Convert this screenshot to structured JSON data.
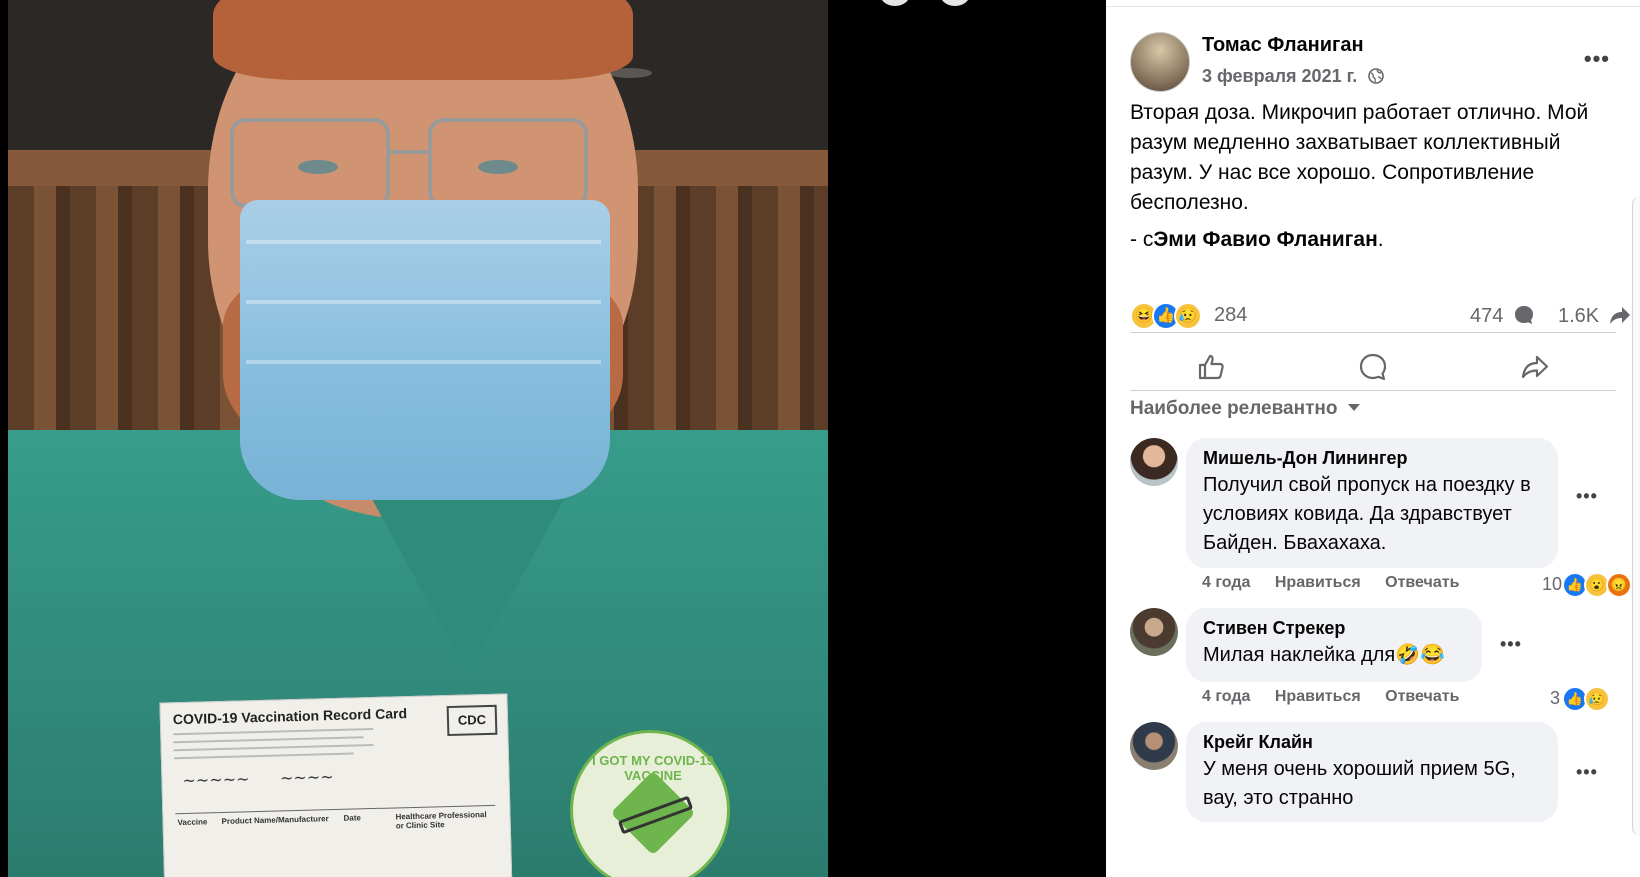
{
  "post": {
    "author": "Томас Фланиган",
    "date": "3 февраля 2021 г.",
    "text": "Вторая доза. Микрочип работает отлично. Мой разум медленно захватывает коллективный разум. У нас все хорошо. Сопротивление бесполезно.",
    "tag_prefix": "-  с",
    "tag_name": "Эми Фавио Фланиган",
    "tag_suffix": ".",
    "reaction_count": "284",
    "comment_count": "474",
    "share_count": "1.6K",
    "reaction_icons": [
      "haha-icon",
      "like-icon",
      "sad-icon"
    ]
  },
  "photo": {
    "card_title": "COVID-19 Vaccination Record Card",
    "card_badge": "CDC",
    "sticker_text": "I GOT MY COVID-19 VACCINE",
    "card_grid_headers": [
      "Vaccine",
      "Product Name/Manufacturer",
      "Date",
      "Healthcare Professional or Clinic Site"
    ]
  },
  "sort": {
    "label": "Наиболее релевантно"
  },
  "actions": [
    "like",
    "comment",
    "share"
  ],
  "comments": [
    {
      "name": "Мишель-Дон Линингер",
      "text": "Получил свой пропуск на поездку в условиях ковида. Да здравствует Байден. Бвахахаха.",
      "time": "4 года",
      "like_label": "Нравиться",
      "reply_label": "Отвечать",
      "reaction_count": "10",
      "reactions": [
        "like-icon",
        "wow-icon",
        "angry-icon"
      ]
    },
    {
      "name": "Стивен Стрекер",
      "text": "Милая наклейка для🤣😂",
      "time": "4 года",
      "like_label": "Нравиться",
      "reply_label": "Отвечать",
      "reaction_count": "3",
      "reactions": [
        "like-icon",
        "sad-icon"
      ]
    },
    {
      "name": "Крейг Клайн",
      "text": "У меня очень хороший прием 5G, вау, это странно",
      "time": "",
      "like_label": "",
      "reply_label": "",
      "reaction_count": "",
      "reactions": []
    }
  ],
  "colors": {
    "secondary_text": "#65676b",
    "bubble": "#f0f2f5",
    "like_blue": "#1877f2",
    "reaction_yellow": "#f7c33d"
  }
}
